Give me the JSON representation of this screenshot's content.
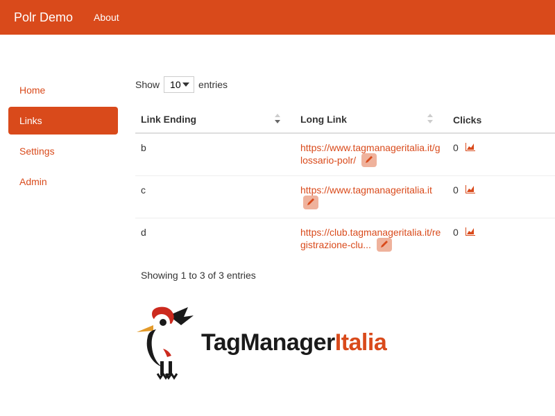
{
  "navbar": {
    "brand": "Polr Demo",
    "about": "About"
  },
  "sidebar": {
    "items": [
      {
        "label": "Home",
        "active": false
      },
      {
        "label": "Links",
        "active": true
      },
      {
        "label": "Settings",
        "active": false
      },
      {
        "label": "Admin",
        "active": false
      }
    ]
  },
  "table_controls": {
    "show_prefix": "Show",
    "show_suffix": "entries",
    "page_length": "10"
  },
  "columns": {
    "link_ending": "Link Ending",
    "long_link": "Long Link",
    "clicks": "Clicks"
  },
  "rows": [
    {
      "ending": "b",
      "long_link": "https://www.tagmanageritalia.it/glossario-polr/",
      "clicks": "0"
    },
    {
      "ending": "c",
      "long_link": "https://www.tagmanageritalia.it",
      "clicks": "0"
    },
    {
      "ending": "d",
      "long_link": "https://club.tagmanageritalia.it/registrazione-clu...",
      "clicks": "0"
    }
  ],
  "info": "Showing 1 to 3 of 3 entries",
  "logo": {
    "part1": "TagManager",
    "part2": "Italia"
  }
}
